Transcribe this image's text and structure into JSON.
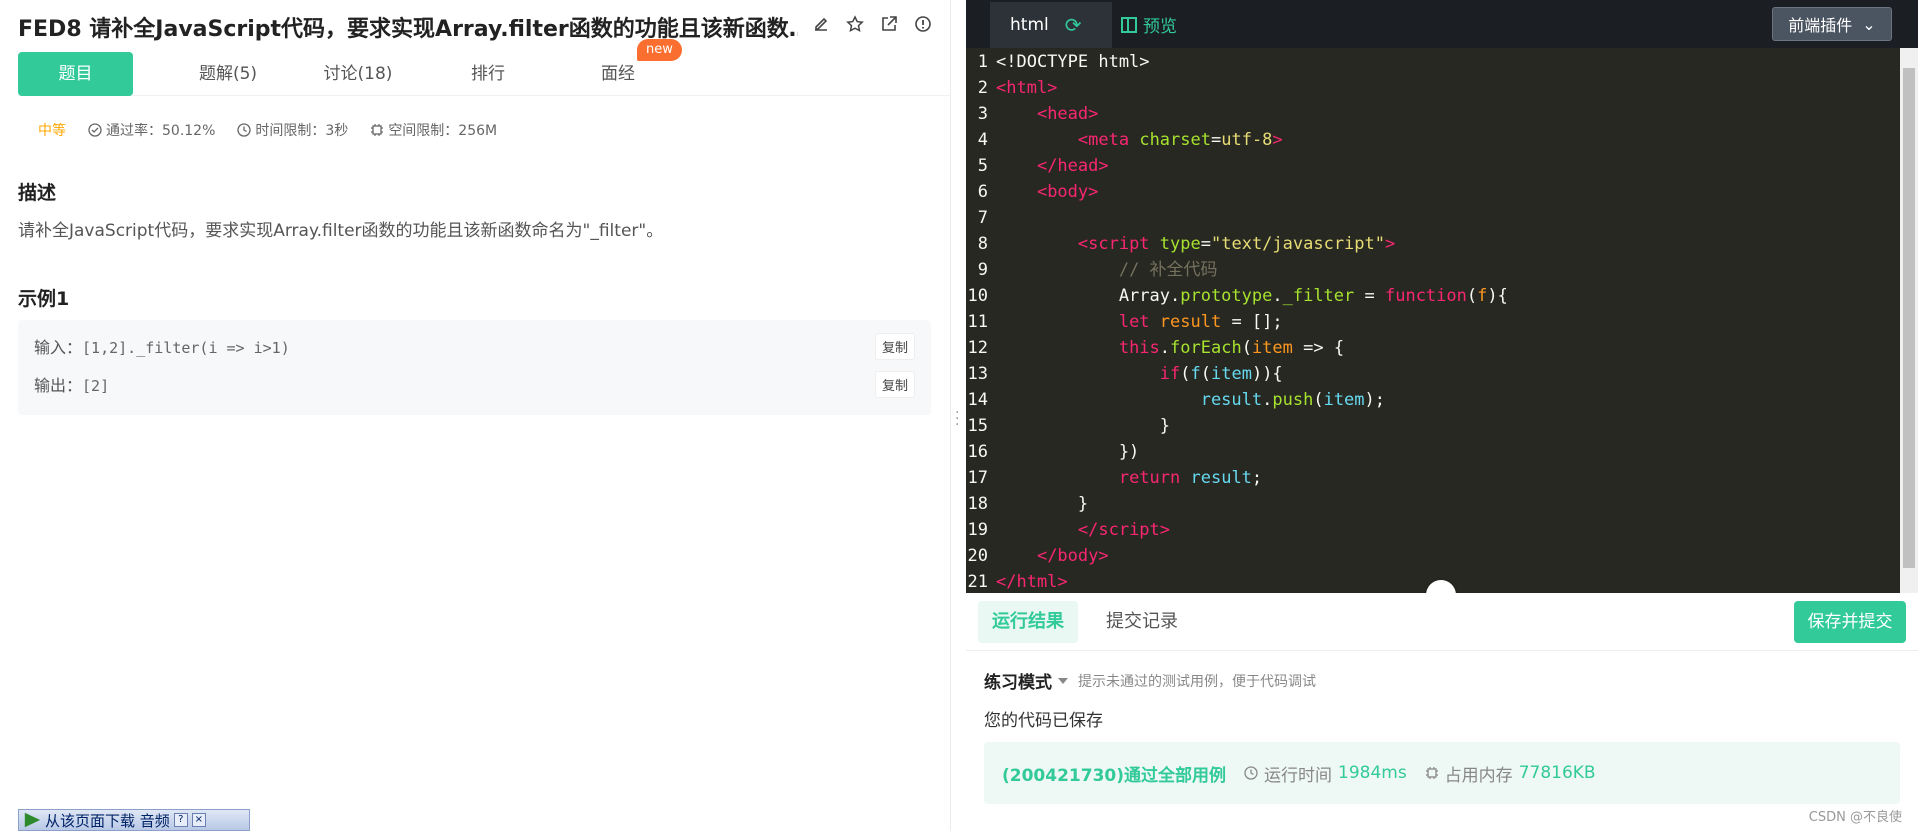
{
  "problem": {
    "title": "FED8  请补全JavaScript代码，要求实现Array.filter函数的功能且该新函数…",
    "tabs": [
      "题目",
      "题解(5)",
      "讨论(18)",
      "排行",
      "面经"
    ],
    "new_badge": "new",
    "level": "中等",
    "pass_rate": "通过率：50.12%",
    "time_limit": "时间限制：3秒",
    "space_limit": "空间限制：256M",
    "desc_heading": "描述",
    "desc_text": "请补全JavaScript代码，要求实现Array.filter函数的功能且该新函数命名为\"_filter\"。",
    "example_heading": "示例1",
    "example": {
      "input_label": "输入：",
      "input_value": "[1,2]._filter(i => i>1)",
      "output_label": "输出：",
      "output_value": "[2]",
      "copy_label": "复制"
    }
  },
  "download_bar": {
    "label": "从该页面下载 音频",
    "help": "?",
    "close": "×"
  },
  "editor": {
    "file_tab": "html",
    "preview_label": "预览",
    "plugin_label": "前端插件",
    "line_numbers": [
      "1",
      "2",
      "3",
      "4",
      "5",
      "6",
      "7",
      "8",
      "9",
      "10",
      "11",
      "12",
      "13",
      "14",
      "15",
      "16",
      "17",
      "18",
      "19",
      "20",
      "21"
    ]
  },
  "results": {
    "tab_run": "运行结果",
    "tab_history": "提交记录",
    "submit_label": "保存并提交",
    "mode_title": "练习模式",
    "mode_hint": "提示未通过的测试用例，便于代码调试",
    "saved_text": "您的代码已保存",
    "pass_text": "(200421730)通过全部用例",
    "runtime_label": "运行时间",
    "runtime_value": "1984ms",
    "memory_label": "占用内存",
    "memory_value": "77816KB"
  },
  "watermark": "CSDN @不良使",
  "colors": {
    "accent": "#32ca99",
    "badge": "#fa6f2f",
    "level": "#ffa800",
    "editor_bg": "#272822"
  }
}
